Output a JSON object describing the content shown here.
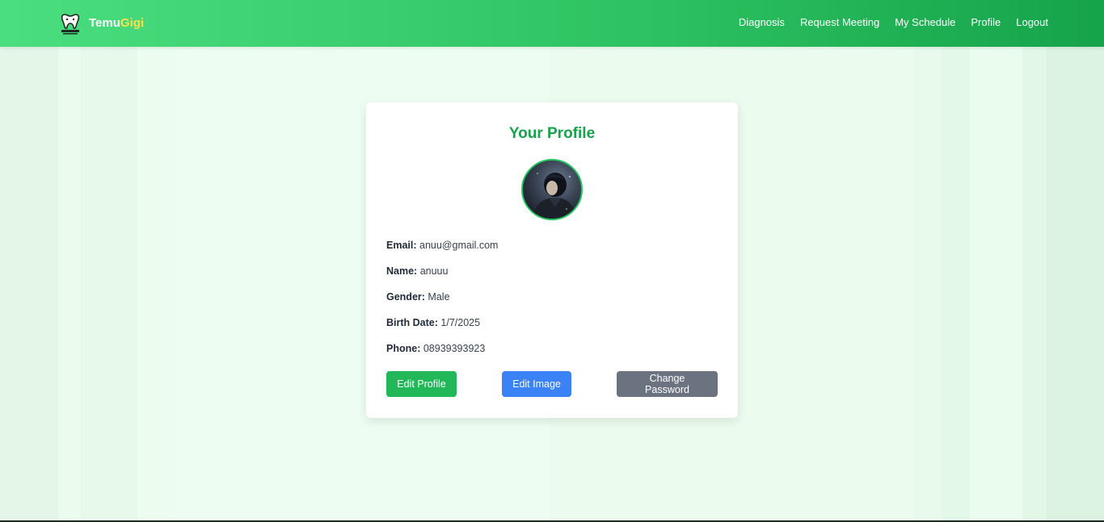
{
  "brand": {
    "part1": "Temu",
    "part2": "Gigi",
    "logo_text": "TEMUGIGI"
  },
  "nav": [
    {
      "label": "Diagnosis"
    },
    {
      "label": "Request Meeting"
    },
    {
      "label": "My Schedule"
    },
    {
      "label": "Profile"
    },
    {
      "label": "Logout"
    }
  ],
  "profile": {
    "title": "Your Profile",
    "fields": [
      {
        "label": "Email:",
        "value": "anuu@gmail.com"
      },
      {
        "label": "Name:",
        "value": "anuuu"
      },
      {
        "label": "Gender:",
        "value": "Male"
      },
      {
        "label": "Birth Date:",
        "value": "1/7/2025"
      },
      {
        "label": "Phone:",
        "value": "08939393923"
      }
    ],
    "buttons": {
      "edit_profile": "Edit Profile",
      "edit_image": "Edit Image",
      "change_password": "Change Password"
    }
  },
  "colors": {
    "header_start": "#4ade80",
    "header_end": "#16a34a",
    "brand_accent": "#fde047",
    "title": "#16a34a",
    "edit_profile_btn": "#22b85a",
    "edit_image_btn": "#3b82f6",
    "change_password_btn": "#6b7280"
  }
}
